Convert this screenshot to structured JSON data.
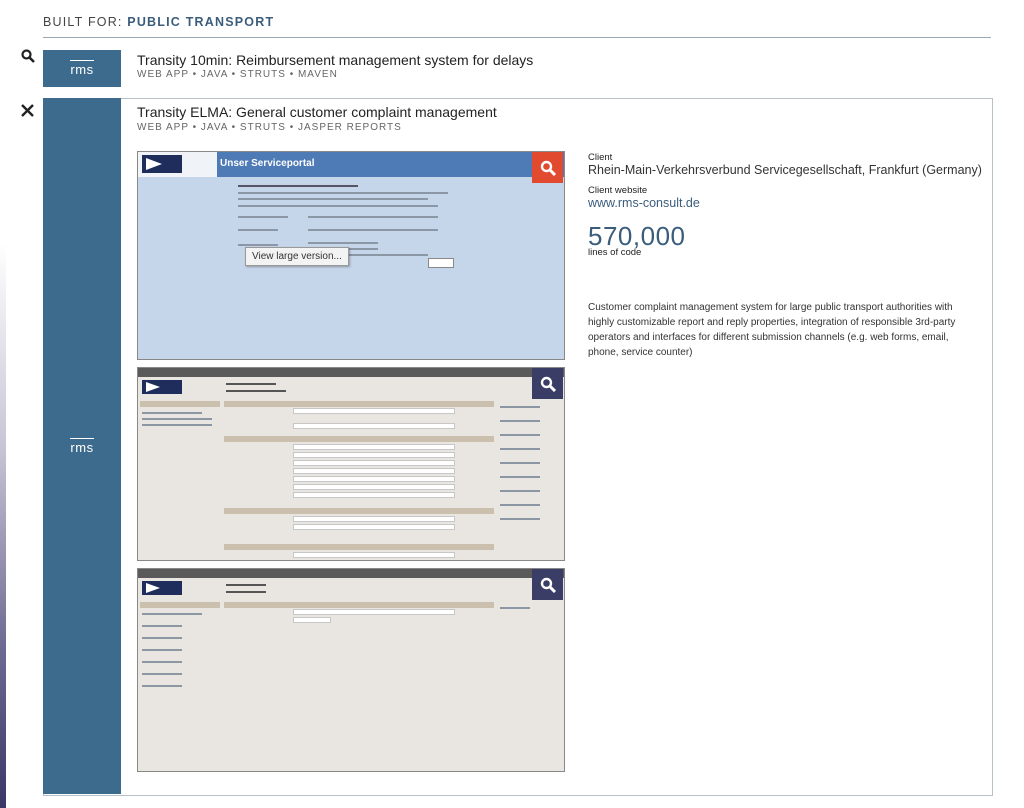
{
  "header": {
    "prefix": "BUILT FOR:",
    "category": "PUBLIC TRANSPORT"
  },
  "projects": [
    {
      "title": "Transity 10min: Reimbursement management system for delays",
      "tags": "WEB APP • JAVA • STRUTS • MAVEN",
      "toggle_icon": "search-icon",
      "logo_text": "rms"
    },
    {
      "title": "Transity ELMA: General customer complaint management",
      "tags": "WEB APP • JAVA • STRUTS • JASPER REPORTS",
      "toggle_icon": "close-icon",
      "logo_text": "rms",
      "screens": {
        "portal_title": "Unser Serviceportal",
        "view_large": "View large version..."
      },
      "client_label": "Client",
      "client": "Rhein-Main-Verkehrsverbund Servicegesellschaft, Frankfurt (Germany)",
      "website_label": "Client website",
      "website": "www.rms-consult.de",
      "loc": "570,000",
      "loc_label": "lines of code",
      "description": "Customer complaint management system for large public transport authorities with highly customizable report and reply properties, integration of responsible 3rd-party operators and interfaces for different submission channels (e.g. web forms, email, phone, service counter)"
    }
  ],
  "colors": {
    "accent_blue": "#3b5d7c",
    "tile": "#3d6b8e",
    "zoom_red": "#e24a2f",
    "zoom_navy": "#3a3d66"
  }
}
